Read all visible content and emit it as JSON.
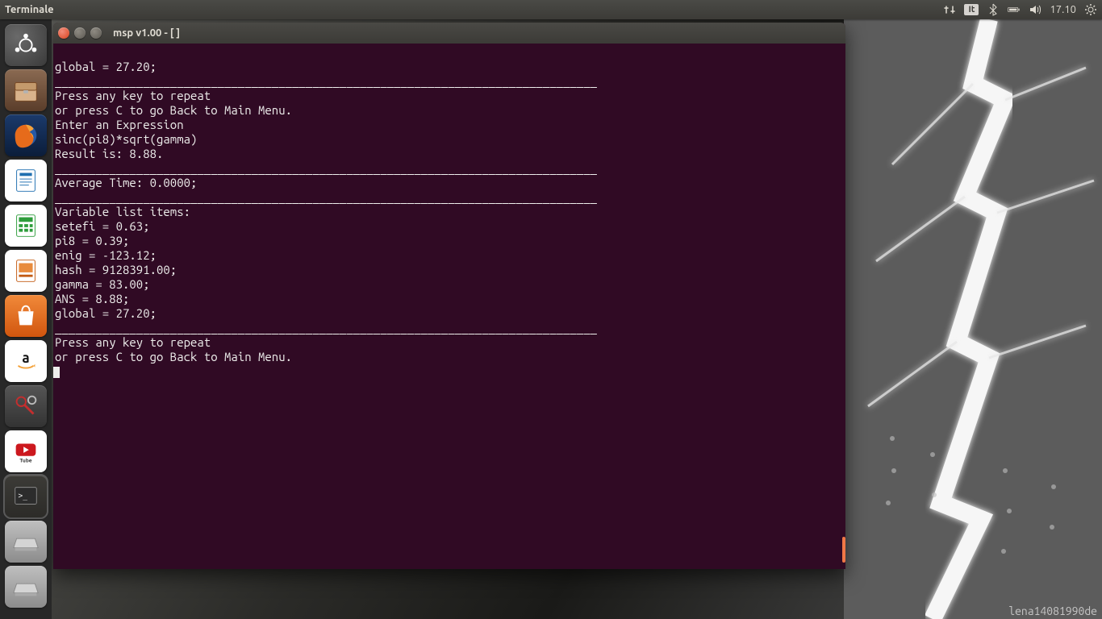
{
  "top_panel": {
    "app_name": "Terminale",
    "lang": "It",
    "time": "17.10"
  },
  "launcher": {
    "items": [
      {
        "name": "dash"
      },
      {
        "name": "files"
      },
      {
        "name": "firefox"
      },
      {
        "name": "writer"
      },
      {
        "name": "calc"
      },
      {
        "name": "impress"
      },
      {
        "name": "software"
      },
      {
        "name": "amazon"
      },
      {
        "name": "settings"
      },
      {
        "name": "youtube"
      },
      {
        "name": "terminal"
      },
      {
        "name": "drive1"
      },
      {
        "name": "drive2"
      }
    ]
  },
  "terminal": {
    "title": "msp v1.00 - [ ]",
    "lines": [
      "global = 27.20;",
      "",
      "________________________________________________________________________________",
      "",
      "Press any key to repeat",
      "or press C to go Back to Main Menu.",
      "Enter an Expression",
      "",
      "sinc(pi8)*sqrt(gamma)",
      "",
      "",
      "Result is: 8.88.",
      "",
      "",
      "________________________________________________________________________________",
      "",
      "Average Time: 0.0000;",
      "",
      "________________________________________________________________________________",
      "",
      "",
      "Variable list items:",
      "",
      "setefi = 0.63;",
      "pi8 = 0.39;",
      "enig = -123.12;",
      "hash = 9128391.00;",
      "gamma = 83.00;",
      "ANS = 8.88;",
      "global = 27.20;",
      "",
      "________________________________________________________________________________",
      "",
      "Press any key to repeat",
      "or press C to go Back to Main Menu."
    ]
  },
  "watermark": "lena14081990de"
}
